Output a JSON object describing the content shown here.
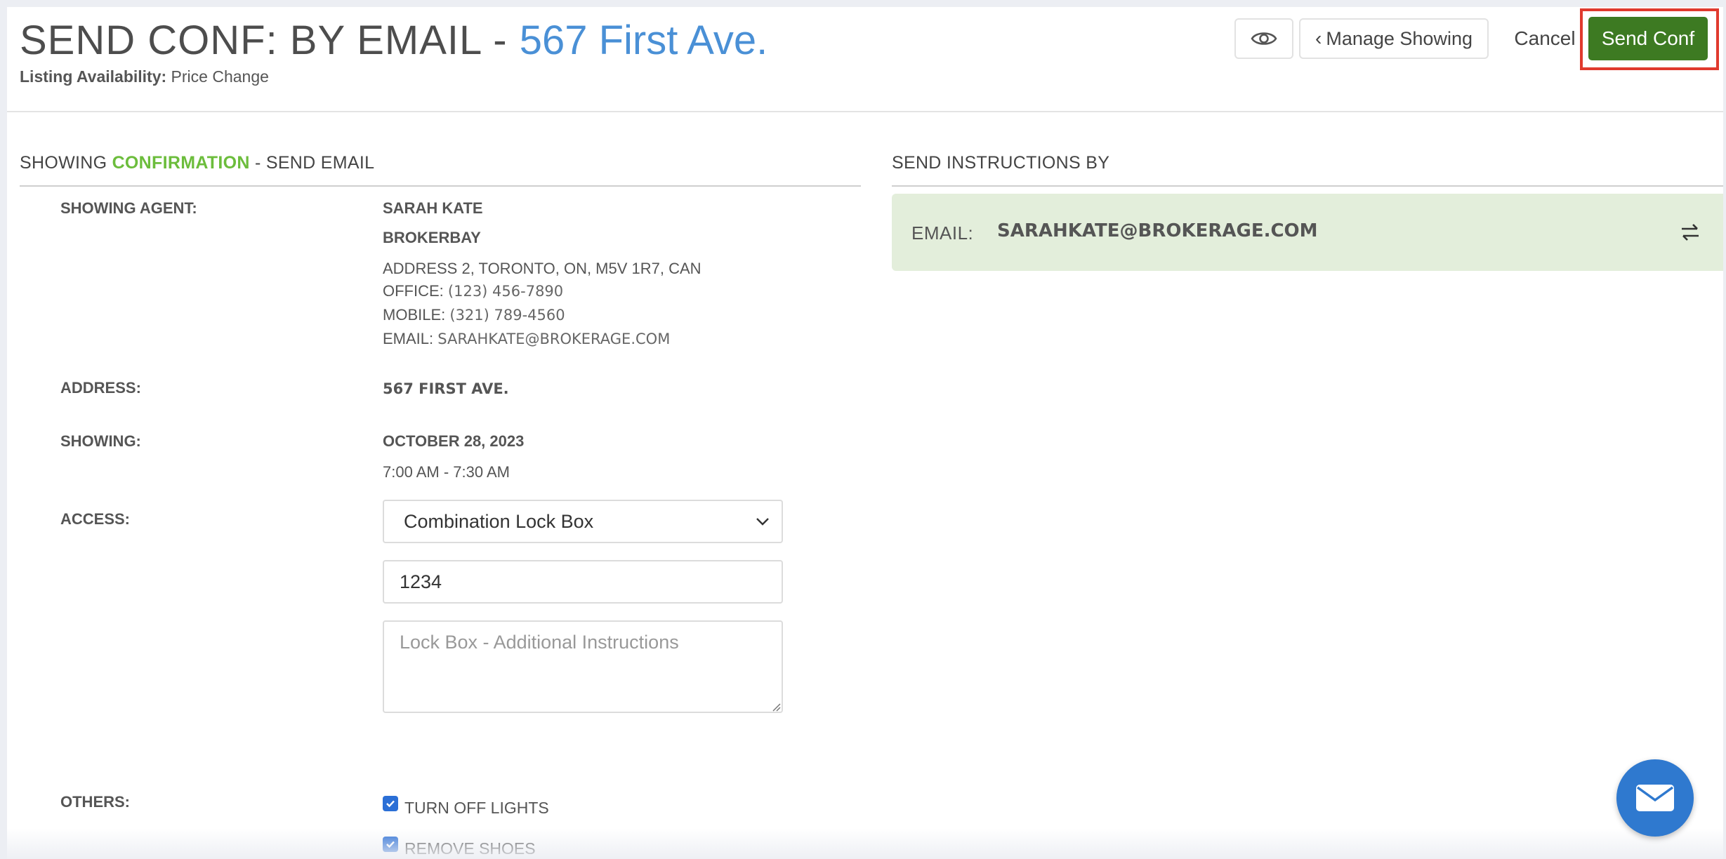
{
  "header": {
    "title_prefix": "SEND CONF: BY EMAIL - ",
    "title_address": "567 First Ave.",
    "availability_label": "Listing Availability:",
    "availability_value": "Price Change",
    "preview_icon": "eye-icon",
    "manage_label": "Manage Showing",
    "cancel_label": "Cancel",
    "send_label": "Send Conf"
  },
  "confirmation": {
    "heading_prefix": "SHOWING ",
    "heading_highlight": "CONFIRMATION",
    "heading_suffix": " - SEND EMAIL",
    "agent": {
      "label": "SHOWING AGENT:",
      "name": "SARAH KATE",
      "brokerage": "BROKERBAY",
      "address": "ADDRESS 2, TORONTO, ON, M5V 1R7, CAN",
      "office_label": "OFFICE:",
      "office": "(123) 456-7890",
      "mobile_label": "MOBILE:",
      "mobile": "(321) 789-4560",
      "email_label": "EMAIL:",
      "email": "SARAHKATE@BROKERAGE.COM"
    },
    "address": {
      "label": "ADDRESS:",
      "value": "567 FIRST AVE."
    },
    "showing": {
      "label": "SHOWING:",
      "date": "OCTOBER 28, 2023",
      "time": "7:00 AM - 7:30 AM"
    },
    "access": {
      "label": "ACCESS:",
      "selected": "Combination Lock Box",
      "code": "1234",
      "instructions_placeholder": "Lock Box - Additional Instructions"
    },
    "others": {
      "label": "OTHERS:",
      "items": [
        {
          "label": "TURN OFF LIGHTS",
          "checked": true
        },
        {
          "label": "REMOVE SHOES",
          "checked": true
        }
      ]
    }
  },
  "instructions": {
    "heading": "SEND INSTRUCTIONS BY",
    "method_label": "EMAIL:",
    "method_value": "SARAHKATE@BROKERAGE.COM",
    "swap_icon": "swap-arrows-icon"
  },
  "chat": {
    "icon": "mail-icon"
  },
  "colors": {
    "accent_blue": "#4a90d6",
    "send_green": "#3d7a22",
    "highlight_green": "#6cbd3c",
    "panel_green": "#e3eedb",
    "outline_red": "#e03a2e"
  }
}
